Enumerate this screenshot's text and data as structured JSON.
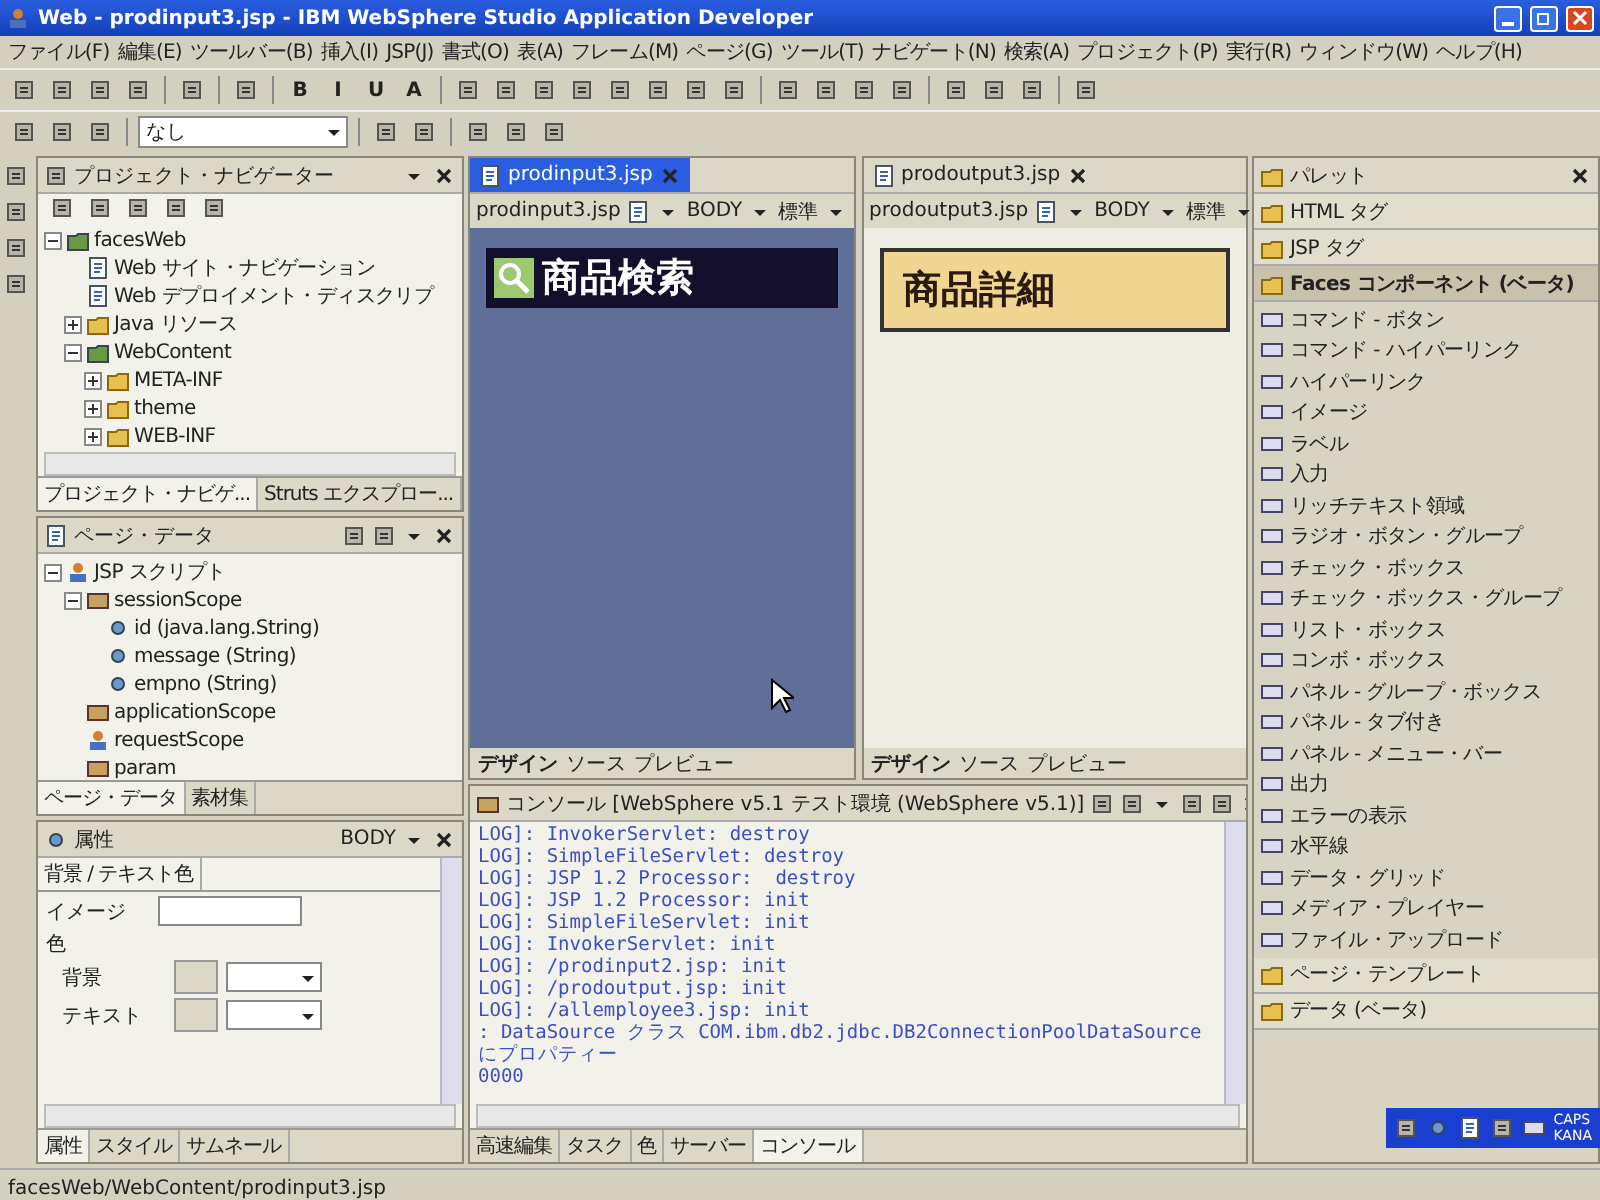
{
  "window": {
    "title": "Web - prodinput3.jsp - IBM WebSphere Studio Application Developer"
  },
  "menu": [
    "ファイル(F)",
    "編集(E)",
    "ツールバー(B)",
    "挿入(I)",
    "JSP(J)",
    "書式(O)",
    "表(A)",
    "フレーム(M)",
    "ページ(G)",
    "ツール(T)",
    "ナビゲート(N)",
    "検索(A)",
    "プロジェクト(P)",
    "実行(R)",
    "ウィンドウ(W)",
    "ヘルプ(H)"
  ],
  "toolbar": {
    "format_buttons": [
      "B",
      "I",
      "U",
      "A"
    ],
    "style_dropdown": "なし"
  },
  "navigator": {
    "title": "プロジェクト・ナビゲーター",
    "tree": [
      {
        "label": "facesWeb",
        "kind": "project",
        "expanded": true,
        "children": [
          {
            "label": "Web サイト・ナビゲーション",
            "kind": "file"
          },
          {
            "label": "Web デプロイメント・ディスクリプ",
            "kind": "file"
          },
          {
            "label": "Java リソース",
            "kind": "folder",
            "expanded": false
          },
          {
            "label": "WebContent",
            "kind": "project",
            "expanded": true,
            "children": [
              {
                "label": "META-INF",
                "kind": "folder",
                "expanded": false
              },
              {
                "label": "theme",
                "kind": "folder",
                "expanded": false
              },
              {
                "label": "WEB-INF",
                "kind": "folder",
                "expanded": false
              }
            ]
          }
        ]
      }
    ],
    "tabs": [
      {
        "label": "プロジェクト・ナビゲ...",
        "selected": true
      },
      {
        "label": "Struts エクスプロー...",
        "selected": false
      }
    ]
  },
  "page_data": {
    "title": "ページ・データ",
    "tree": [
      {
        "label": "JSP スクリプト",
        "kind": "script",
        "expanded": true,
        "children": [
          {
            "label": "sessionScope",
            "kind": "scope",
            "expanded": true,
            "children": [
              {
                "label": "id (java.lang.String)",
                "kind": "field"
              },
              {
                "label": "message (String)",
                "kind": "field"
              },
              {
                "label": "empno (String)",
                "kind": "field"
              }
            ]
          },
          {
            "label": "applicationScope",
            "kind": "scope"
          },
          {
            "label": "requestScope",
            "kind": "script"
          },
          {
            "label": "param",
            "kind": "scope"
          }
        ]
      }
    ],
    "tabs": [
      {
        "label": "ページ・データ",
        "selected": true
      },
      {
        "label": "素材集",
        "selected": false
      }
    ]
  },
  "properties": {
    "title": "属性",
    "element": "BODY",
    "tab": "背景 / テキスト色",
    "image_label": "イメージ",
    "color_label": "色",
    "fields": [
      {
        "label": "背景"
      },
      {
        "label": "テキスト"
      }
    ],
    "tabs": [
      {
        "label": "属性",
        "selected": true
      },
      {
        "label": "スタイル",
        "selected": false
      },
      {
        "label": "サムネール",
        "selected": false
      }
    ]
  },
  "editors": [
    {
      "tab": "prodinput3.jsp",
      "selected": true,
      "file": "prodinput3.jsp",
      "element": "BODY",
      "style": "標準",
      "heading": "商品検索",
      "kind": "dark",
      "mode_tabs": [
        {
          "label": "デザイン",
          "selected": true
        },
        {
          "label": "ソース",
          "selected": false
        },
        {
          "label": "プレビュー",
          "selected": false
        }
      ]
    },
    {
      "tab": "prodoutput3.jsp",
      "selected": false,
      "file": "prodoutput3.jsp",
      "element": "BODY",
      "style": "標準",
      "heading": "商品詳細",
      "kind": "light",
      "mode_tabs": [
        {
          "label": "デザイン",
          "selected": true
        },
        {
          "label": "ソース",
          "selected": false
        },
        {
          "label": "プレビュー",
          "selected": false
        }
      ]
    }
  ],
  "console": {
    "title": "コンソール [WebSphere v5.1 テスト環境 (WebSphere v5.1)]",
    "lines": [
      "LOG]: InvokerServlet: destroy",
      "LOG]: SimpleFileServlet: destroy",
      "LOG]: JSP 1.2 Processor:  destroy",
      "LOG]: JSP 1.2 Processor: init",
      "LOG]: SimpleFileServlet: init",
      "LOG]: InvokerServlet: init",
      "LOG]: /prodinput2.jsp: init",
      "LOG]: /prodoutput.jsp: init",
      "LOG]: /allemployee3.jsp: init",
      ": DataSource クラス COM.ibm.db2.jdbc.DB2ConnectionPoolDataSource にプロパティー",
      "0000"
    ],
    "tabs": [
      {
        "label": "高速編集",
        "selected": false
      },
      {
        "label": "タスク",
        "selected": false
      },
      {
        "label": "色",
        "selected": false
      },
      {
        "label": "サーバー",
        "selected": false
      },
      {
        "label": "コンソール",
        "selected": true
      }
    ]
  },
  "palette": {
    "title": "パレット",
    "drawers": [
      {
        "label": "HTML タグ",
        "expanded": false
      },
      {
        "label": "JSP タグ",
        "expanded": false
      },
      {
        "label": "Faces コンポーネント (ベータ)",
        "expanded": true,
        "items": [
          "コマンド - ボタン",
          "コマンド - ハイパーリンク",
          "ハイパーリンク",
          "イメージ",
          "ラベル",
          "入力",
          "リッチテキスト領域",
          "ラジオ・ボタン・グループ",
          "チェック・ボックス",
          "チェック・ボックス・グループ",
          "リスト・ボックス",
          "コンボ・ボックス",
          "パネル - グループ・ボックス",
          "パネル - タブ付き",
          "パネル - メニュー・バー",
          "出力",
          "エラーの表示",
          "水平線",
          "データ・グリッド",
          "メディア・プレイヤー",
          "ファイル・アップロード"
        ]
      },
      {
        "label": "ページ・テンプレート",
        "expanded": false
      },
      {
        "label": "データ (ベータ)",
        "expanded": false
      }
    ]
  },
  "status_bar": {
    "path": "facesWeb/WebContent/prodinput3.jsp"
  },
  "ime_bar": {
    "caps": "CAPS",
    "kana": "KANA"
  }
}
